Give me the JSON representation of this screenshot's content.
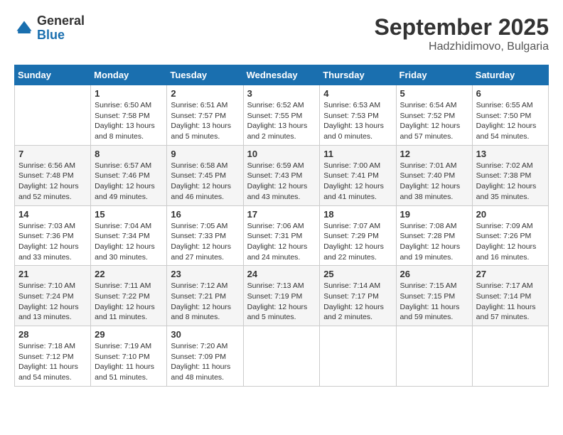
{
  "logo": {
    "general": "General",
    "blue": "Blue"
  },
  "header": {
    "month": "September 2025",
    "location": "Hadzhidimovo, Bulgaria"
  },
  "weekdays": [
    "Sunday",
    "Monday",
    "Tuesday",
    "Wednesday",
    "Thursday",
    "Friday",
    "Saturday"
  ],
  "weeks": [
    [
      {
        "day": "",
        "info": ""
      },
      {
        "day": "1",
        "info": "Sunrise: 6:50 AM\nSunset: 7:58 PM\nDaylight: 13 hours\nand 8 minutes."
      },
      {
        "day": "2",
        "info": "Sunrise: 6:51 AM\nSunset: 7:57 PM\nDaylight: 13 hours\nand 5 minutes."
      },
      {
        "day": "3",
        "info": "Sunrise: 6:52 AM\nSunset: 7:55 PM\nDaylight: 13 hours\nand 2 minutes."
      },
      {
        "day": "4",
        "info": "Sunrise: 6:53 AM\nSunset: 7:53 PM\nDaylight: 13 hours\nand 0 minutes."
      },
      {
        "day": "5",
        "info": "Sunrise: 6:54 AM\nSunset: 7:52 PM\nDaylight: 12 hours\nand 57 minutes."
      },
      {
        "day": "6",
        "info": "Sunrise: 6:55 AM\nSunset: 7:50 PM\nDaylight: 12 hours\nand 54 minutes."
      }
    ],
    [
      {
        "day": "7",
        "info": "Sunrise: 6:56 AM\nSunset: 7:48 PM\nDaylight: 12 hours\nand 52 minutes."
      },
      {
        "day": "8",
        "info": "Sunrise: 6:57 AM\nSunset: 7:46 PM\nDaylight: 12 hours\nand 49 minutes."
      },
      {
        "day": "9",
        "info": "Sunrise: 6:58 AM\nSunset: 7:45 PM\nDaylight: 12 hours\nand 46 minutes."
      },
      {
        "day": "10",
        "info": "Sunrise: 6:59 AM\nSunset: 7:43 PM\nDaylight: 12 hours\nand 43 minutes."
      },
      {
        "day": "11",
        "info": "Sunrise: 7:00 AM\nSunset: 7:41 PM\nDaylight: 12 hours\nand 41 minutes."
      },
      {
        "day": "12",
        "info": "Sunrise: 7:01 AM\nSunset: 7:40 PM\nDaylight: 12 hours\nand 38 minutes."
      },
      {
        "day": "13",
        "info": "Sunrise: 7:02 AM\nSunset: 7:38 PM\nDaylight: 12 hours\nand 35 minutes."
      }
    ],
    [
      {
        "day": "14",
        "info": "Sunrise: 7:03 AM\nSunset: 7:36 PM\nDaylight: 12 hours\nand 33 minutes."
      },
      {
        "day": "15",
        "info": "Sunrise: 7:04 AM\nSunset: 7:34 PM\nDaylight: 12 hours\nand 30 minutes."
      },
      {
        "day": "16",
        "info": "Sunrise: 7:05 AM\nSunset: 7:33 PM\nDaylight: 12 hours\nand 27 minutes."
      },
      {
        "day": "17",
        "info": "Sunrise: 7:06 AM\nSunset: 7:31 PM\nDaylight: 12 hours\nand 24 minutes."
      },
      {
        "day": "18",
        "info": "Sunrise: 7:07 AM\nSunset: 7:29 PM\nDaylight: 12 hours\nand 22 minutes."
      },
      {
        "day": "19",
        "info": "Sunrise: 7:08 AM\nSunset: 7:28 PM\nDaylight: 12 hours\nand 19 minutes."
      },
      {
        "day": "20",
        "info": "Sunrise: 7:09 AM\nSunset: 7:26 PM\nDaylight: 12 hours\nand 16 minutes."
      }
    ],
    [
      {
        "day": "21",
        "info": "Sunrise: 7:10 AM\nSunset: 7:24 PM\nDaylight: 12 hours\nand 13 minutes."
      },
      {
        "day": "22",
        "info": "Sunrise: 7:11 AM\nSunset: 7:22 PM\nDaylight: 12 hours\nand 11 minutes."
      },
      {
        "day": "23",
        "info": "Sunrise: 7:12 AM\nSunset: 7:21 PM\nDaylight: 12 hours\nand 8 minutes."
      },
      {
        "day": "24",
        "info": "Sunrise: 7:13 AM\nSunset: 7:19 PM\nDaylight: 12 hours\nand 5 minutes."
      },
      {
        "day": "25",
        "info": "Sunrise: 7:14 AM\nSunset: 7:17 PM\nDaylight: 12 hours\nand 2 minutes."
      },
      {
        "day": "26",
        "info": "Sunrise: 7:15 AM\nSunset: 7:15 PM\nDaylight: 11 hours\nand 59 minutes."
      },
      {
        "day": "27",
        "info": "Sunrise: 7:17 AM\nSunset: 7:14 PM\nDaylight: 11 hours\nand 57 minutes."
      }
    ],
    [
      {
        "day": "28",
        "info": "Sunrise: 7:18 AM\nSunset: 7:12 PM\nDaylight: 11 hours\nand 54 minutes."
      },
      {
        "day": "29",
        "info": "Sunrise: 7:19 AM\nSunset: 7:10 PM\nDaylight: 11 hours\nand 51 minutes."
      },
      {
        "day": "30",
        "info": "Sunrise: 7:20 AM\nSunset: 7:09 PM\nDaylight: 11 hours\nand 48 minutes."
      },
      {
        "day": "",
        "info": ""
      },
      {
        "day": "",
        "info": ""
      },
      {
        "day": "",
        "info": ""
      },
      {
        "day": "",
        "info": ""
      }
    ]
  ]
}
